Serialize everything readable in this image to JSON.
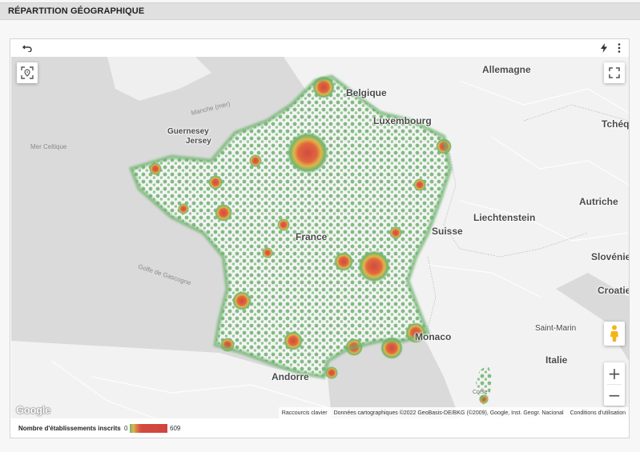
{
  "section": {
    "title": "RÉPARTITION GÉOGRAPHIQUE"
  },
  "toolbar": {
    "undo_icon": "undo-icon",
    "lightning_icon": "lightning-icon",
    "menu_icon": "more-vert-icon"
  },
  "map": {
    "controls": {
      "locate_icon": "locate-icon",
      "fullscreen_icon": "fullscreen-icon",
      "pegman_icon": "pegman-icon",
      "zoom_in": "+",
      "zoom_out": "−"
    },
    "labels": {
      "allemagne": "Allemagne",
      "belgique": "Belgique",
      "luxembourg": "Luxembourg",
      "tcheque": "Tchéqu",
      "manche": "Manche (mer)",
      "guernesey": "Guernesey",
      "jersey": "Jersey",
      "mer_celtique": "Mer Celtique",
      "autriche": "Autriche",
      "liechtenstein": "Liechtenstein",
      "suisse": "Suisse",
      "france": "France",
      "slovenie": "Slovénie",
      "golfe": "Golfe de Gascogne",
      "croatie": "Croatie",
      "saint_marin": "Saint-Marin",
      "monaco": "Monaco",
      "italie": "Italie",
      "andorre": "Andorre",
      "corse": "Corse"
    },
    "google_logo": "Google",
    "attribution": {
      "shortcuts": "Raccourcis clavier",
      "data": "Données cartographiques ©2022 GeoBasis-DE/BKG (©2009), Google, Inst. Geogr. Nacional",
      "terms": "Conditions d'utilisation"
    }
  },
  "legend": {
    "title": "Nombre d'établissements inscrits",
    "min": "0",
    "max": "609"
  },
  "colors": {
    "heat_low": "#6fb56f",
    "heat_mid": "#e0b548",
    "heat_high": "#d14b3e",
    "land": "#f2f2f2",
    "sea": "#dadada"
  }
}
